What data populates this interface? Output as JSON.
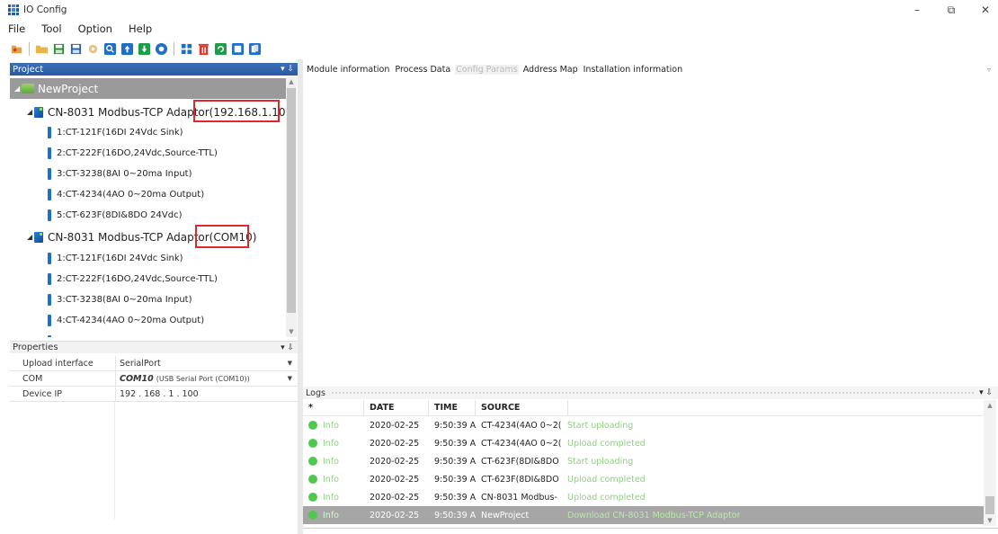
{
  "window": {
    "title": "IO Config",
    "controls": [
      "–",
      "⧉",
      "✕"
    ]
  },
  "menu": [
    "File",
    "Tool",
    "Option",
    "Help"
  ],
  "toolbar": {
    "buttons": [
      {
        "name": "open-icon",
        "color": "#e6a23c"
      },
      {
        "name": "folder-icon",
        "color": "#e8b44a"
      },
      {
        "name": "save-icon",
        "color": "#2c8a3a"
      },
      {
        "name": "save-as-icon",
        "color": "#2b5fa6"
      },
      {
        "name": "settings-icon",
        "color": "#e9c27a"
      },
      {
        "name": "search-icon",
        "color": "#1f6fc9"
      },
      {
        "name": "upload-icon",
        "color": "#1f6fc9"
      },
      {
        "name": "download-icon",
        "color": "#1f9d4a"
      },
      {
        "name": "info-icon",
        "color": "#1f6fc9"
      },
      {
        "name": "grid-icon",
        "color": "#1f6fc9"
      },
      {
        "name": "delete-icon",
        "color": "#d9382f"
      },
      {
        "name": "refresh-icon",
        "color": "#1f9d4a"
      },
      {
        "name": "export-icon",
        "color": "#1f6fc9"
      },
      {
        "name": "copy-icon",
        "color": "#1f6fc9"
      }
    ]
  },
  "project_panel": {
    "title": "Project",
    "pin": "▾ ⇩",
    "root": "NewProject",
    "nodes": [
      {
        "label": "CN-8031 Modbus-TCP Adaptor(192.168.1.100)",
        "modules": [
          "1:CT-121F(16DI 24Vdc Sink)",
          "2:CT-222F(16DO,24Vdc,Source-TTL)",
          "3:CT-3238(8AI 0~20ma Input)",
          "4:CT-4234(4AO 0~20ma Output)",
          "5:CT-623F(8DI&8DO 24Vdc)"
        ]
      },
      {
        "label": "CN-8031 Modbus-TCP Adaptor(COM10)",
        "modules": [
          "1:CT-121F(16DI 24Vdc Sink)",
          "2:CT-222F(16DO,24Vdc,Source-TTL)",
          "3:CT-3238(8AI 0~20ma Input)",
          "4:CT-4234(4AO 0~20ma Output)"
        ]
      }
    ]
  },
  "properties_panel": {
    "title": "Properties",
    "pin": "▾ ⇩",
    "rows": [
      {
        "key": "Upload interface",
        "value": "SerialPort",
        "bold": "",
        "dropdown": true
      },
      {
        "key": "COM",
        "value": "(USB Serial Port (COM10))",
        "bold": "COM10",
        "dropdown": true
      },
      {
        "key": "Device IP",
        "value": "192 . 168 .  1  . 100",
        "bold": "",
        "dropdown": false
      }
    ]
  },
  "tabs": [
    {
      "label": "Module information",
      "active": false
    },
    {
      "label": "Process Data",
      "active": false
    },
    {
      "label": "Config Params",
      "active": true
    },
    {
      "label": "Address Map",
      "active": false
    },
    {
      "label": "Installation information",
      "active": false
    }
  ],
  "logs": {
    "title": "Logs",
    "pin": "▾ ⇩",
    "columns": [
      "*",
      "DATE",
      "TIME",
      "SOURCE"
    ],
    "rows": [
      {
        "level": "Info",
        "date": "2020-02-25",
        "time": "9:50:39 A",
        "source": "CT-4234(4AO 0~2(",
        "message": "Start uploading",
        "selected": false
      },
      {
        "level": "Info",
        "date": "2020-02-25",
        "time": "9:50:39 A",
        "source": "CT-4234(4AO 0~2(",
        "message": "Upload completed",
        "selected": false
      },
      {
        "level": "Info",
        "date": "2020-02-25",
        "time": "9:50:39 A",
        "source": "CT-623F(8DI&8DO",
        "message": "Start uploading",
        "selected": false
      },
      {
        "level": "Info",
        "date": "2020-02-25",
        "time": "9:50:39 A",
        "source": "CT-623F(8DI&8DO",
        "message": "Upload completed",
        "selected": false
      },
      {
        "level": "Info",
        "date": "2020-02-25",
        "time": "9:50:39 A",
        "source": "CN-8031 Modbus-",
        "message": "Upload completed",
        "selected": false
      },
      {
        "level": "Info",
        "date": "2020-02-25",
        "time": "9:50:39 A",
        "source": "NewProject",
        "message": "Download CN-8031 Modbus-TCP Adaptor ",
        "selected": true
      }
    ]
  },
  "colors": {
    "project_header": "#2f5fa6",
    "highlight": "#e0262f",
    "info_green": "#4fc84f",
    "selected_row": "#a6a6a6"
  }
}
